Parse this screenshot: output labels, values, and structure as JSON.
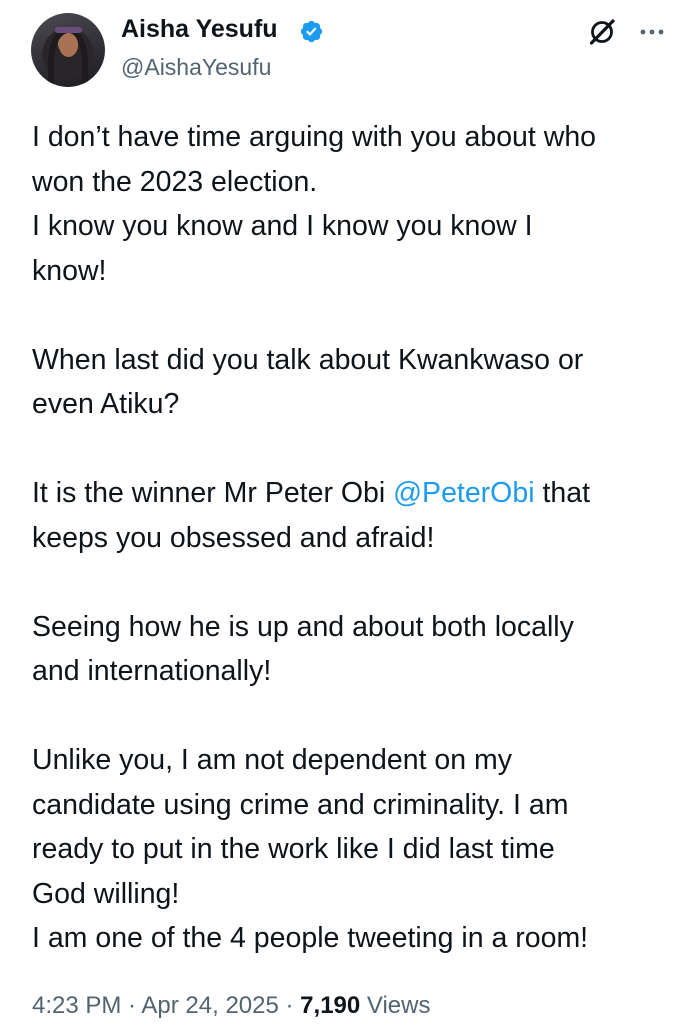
{
  "author": {
    "name": "Aisha Yesufu",
    "handle": "@AishaYesufu",
    "verified": true,
    "verified_color": "#1d9bf0"
  },
  "header_icons": [
    "grok-icon",
    "more-icon"
  ],
  "tweet": {
    "lines": [
      "I don’t have time arguing with you about who",
      "won the 2023 election.",
      "I know you know and I know you know I",
      "know!",
      "When last did you talk about Kwankwaso or",
      "even Atiku?",
      "It is the winner Mr Peter Obi ",
      "@PeterObi",
      " that",
      "keeps you obsessed and afraid!",
      "Seeing how he is up and about both locally",
      "and internationally!",
      "Unlike you, I am not dependent on my",
      "candidate using crime and criminality. I am",
      "ready to put in the work like I did last time",
      "God willing!",
      "I am one of the 4 people tweeting in a room!"
    ],
    "mention_color": "#1d9bf0"
  },
  "meta": {
    "time": "4:23 PM",
    "sep1": " · ",
    "date": "Apr 24, 2025",
    "sep2": " · ",
    "views_count": "7,190",
    "views_label": " Views"
  }
}
